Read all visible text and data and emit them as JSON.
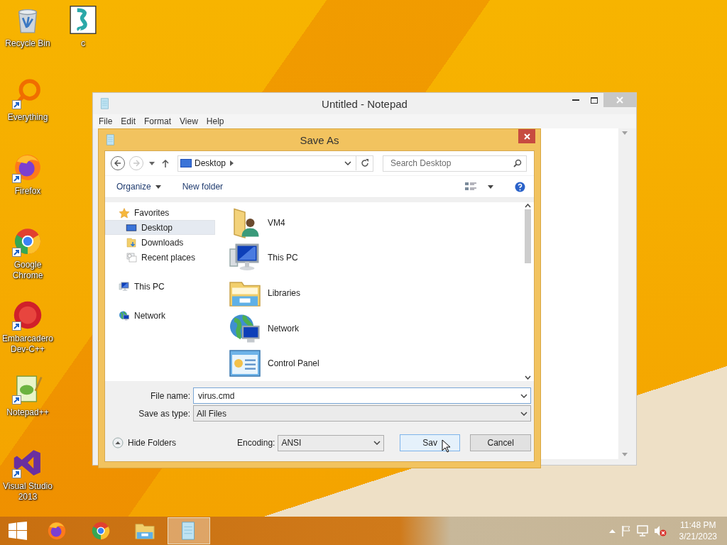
{
  "desktop_icons": [
    {
      "label": "Recycle Bin",
      "kind": "recycle",
      "shortcut": false
    },
    {
      "label": "Everything",
      "kind": "everything",
      "shortcut": true
    },
    {
      "label": "Firefox",
      "kind": "firefox",
      "shortcut": true
    },
    {
      "label": "Google Chrome",
      "kind": "chrome",
      "shortcut": true
    },
    {
      "label": "Embarcadero Dev-C++",
      "kind": "devcpp",
      "shortcut": true
    },
    {
      "label": "Notepad++",
      "kind": "notepadpp",
      "shortcut": true
    },
    {
      "label": "Visual Studio 2013",
      "kind": "vs",
      "shortcut": true
    },
    {
      "label": "c",
      "kind": "script",
      "shortcut": false
    }
  ],
  "notepad": {
    "title": "Untitled - Notepad",
    "menu": [
      "File",
      "Edit",
      "Format",
      "View",
      "Help"
    ]
  },
  "save_as": {
    "title": "Save As",
    "address": "Desktop",
    "search_placeholder": "Search Desktop",
    "organize": "Organize",
    "new_folder": "New folder",
    "sidebar": [
      {
        "label": "Favorites",
        "kind": "favorites",
        "selected": false,
        "children": [
          {
            "label": "Desktop",
            "kind": "desktop",
            "selected": true
          },
          {
            "label": "Downloads",
            "kind": "downloads",
            "selected": false
          },
          {
            "label": "Recent places",
            "kind": "recent",
            "selected": false
          }
        ]
      },
      {
        "label": "This PC",
        "kind": "pc",
        "selected": false
      },
      {
        "label": "Network",
        "kind": "network",
        "selected": false
      }
    ],
    "files": [
      {
        "label": "VM4",
        "kind": "user-folder"
      },
      {
        "label": "This PC",
        "kind": "pc"
      },
      {
        "label": "Libraries",
        "kind": "libraries"
      },
      {
        "label": "Network",
        "kind": "network"
      },
      {
        "label": "Control Panel",
        "kind": "control-panel"
      }
    ],
    "file_name": {
      "label": "File name:",
      "value": "virus.cmd"
    },
    "save_type": {
      "label": "Save as type:",
      "value": "All Files"
    },
    "hide_folders": "Hide Folders",
    "encoding": {
      "label": "Encoding:",
      "value": "ANSI"
    },
    "save_button": "Sav",
    "cancel_button": "Cancel"
  },
  "taskbar": {
    "apps": [
      {
        "kind": "firefox",
        "selected": false
      },
      {
        "kind": "chrome",
        "selected": false
      },
      {
        "kind": "explorer",
        "selected": false
      },
      {
        "kind": "notepad",
        "selected": true
      }
    ],
    "time": "11:48 PM",
    "date": "3/21/2023"
  }
}
